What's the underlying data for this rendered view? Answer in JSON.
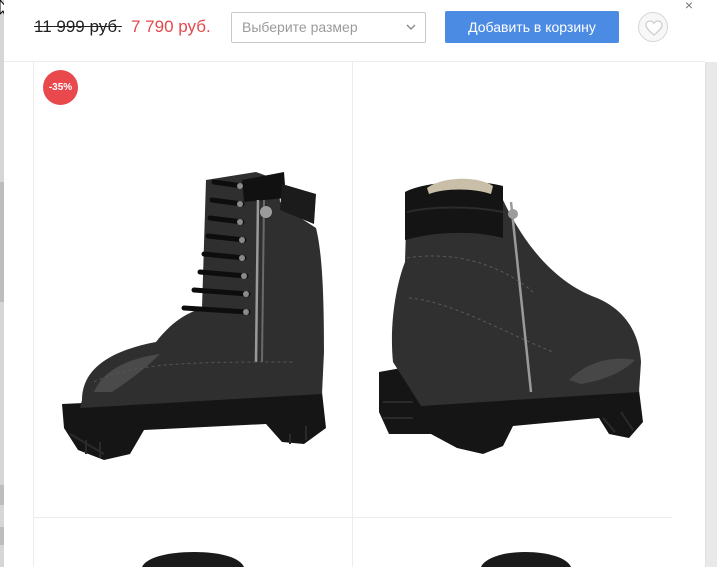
{
  "product_bar": {
    "old_price": "11 999 руб.",
    "new_price": "7 790 руб.",
    "size_select": {
      "placeholder": "Выберите размер"
    },
    "add_to_cart_label": "Добавить в корзину",
    "wishlist_icon": "heart-icon",
    "close_label": "×"
  },
  "gallery": {
    "discount_badge": "-35%",
    "images": [
      {
        "name": "boot-side-view"
      },
      {
        "name": "boot-back-view"
      },
      {
        "name": "boot-top-view-1"
      },
      {
        "name": "boot-top-view-2"
      }
    ]
  },
  "colors": {
    "accent_blue": "#4b8be3",
    "sale_red": "#e5484d",
    "boot_black": "#1f1f1f"
  }
}
